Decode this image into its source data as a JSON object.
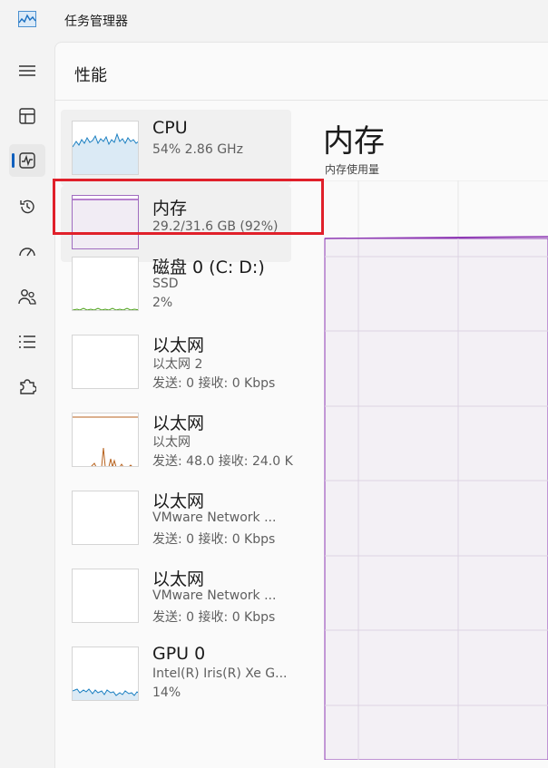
{
  "app": {
    "title": "任务管理器",
    "icon": "performance-chart-icon"
  },
  "nav": {
    "items": [
      {
        "name": "hamburger-menu",
        "icon": "menu-icon"
      },
      {
        "name": "processes",
        "icon": "processes-grid-icon"
      },
      {
        "name": "performance",
        "icon": "performance-pulse-icon",
        "active": true
      },
      {
        "name": "app-history",
        "icon": "history-icon"
      },
      {
        "name": "startup-apps",
        "icon": "startup-gauge-icon"
      },
      {
        "name": "users",
        "icon": "users-icon"
      },
      {
        "name": "details",
        "icon": "details-list-icon"
      },
      {
        "name": "services",
        "icon": "services-puzzle-icon"
      }
    ]
  },
  "page": {
    "title": "性能"
  },
  "resources": [
    {
      "title": "CPU",
      "line1": "54% 2.86 GHz",
      "line2": "",
      "color": "#1a7fc1"
    },
    {
      "title": "内存",
      "line1": "29.2/31.6 GB (92%)",
      "line2": "",
      "color": "#8e39b4",
      "selected": true
    },
    {
      "title": "磁盘 0 (C: D:)",
      "line1": "SSD",
      "line2": "2%",
      "color": "#4ca01a"
    },
    {
      "title": "以太网",
      "line1": "以太网 2",
      "line2": "发送: 0 接收: 0 Kbps",
      "color": "#b7621e"
    },
    {
      "title": "以太网",
      "line1": "以太网",
      "line2": "发送: 48.0 接收: 24.0 K",
      "color": "#b7621e"
    },
    {
      "title": "以太网",
      "line1": "VMware Network ...",
      "line2": "发送: 0 接收: 0 Kbps",
      "color": "#b7621e"
    },
    {
      "title": "以太网",
      "line1": "VMware Network ...",
      "line2": "发送: 0 接收: 0 Kbps",
      "color": "#b7621e"
    },
    {
      "title": "GPU 0",
      "line1": "Intel(R) Iris(R) Xe G...",
      "line2": "14%",
      "color": "#1a7fc1"
    }
  ],
  "detail": {
    "title": "内存",
    "subtitle": "内存使用量",
    "usage_percent": 92,
    "line_color": "#8e39b4"
  }
}
